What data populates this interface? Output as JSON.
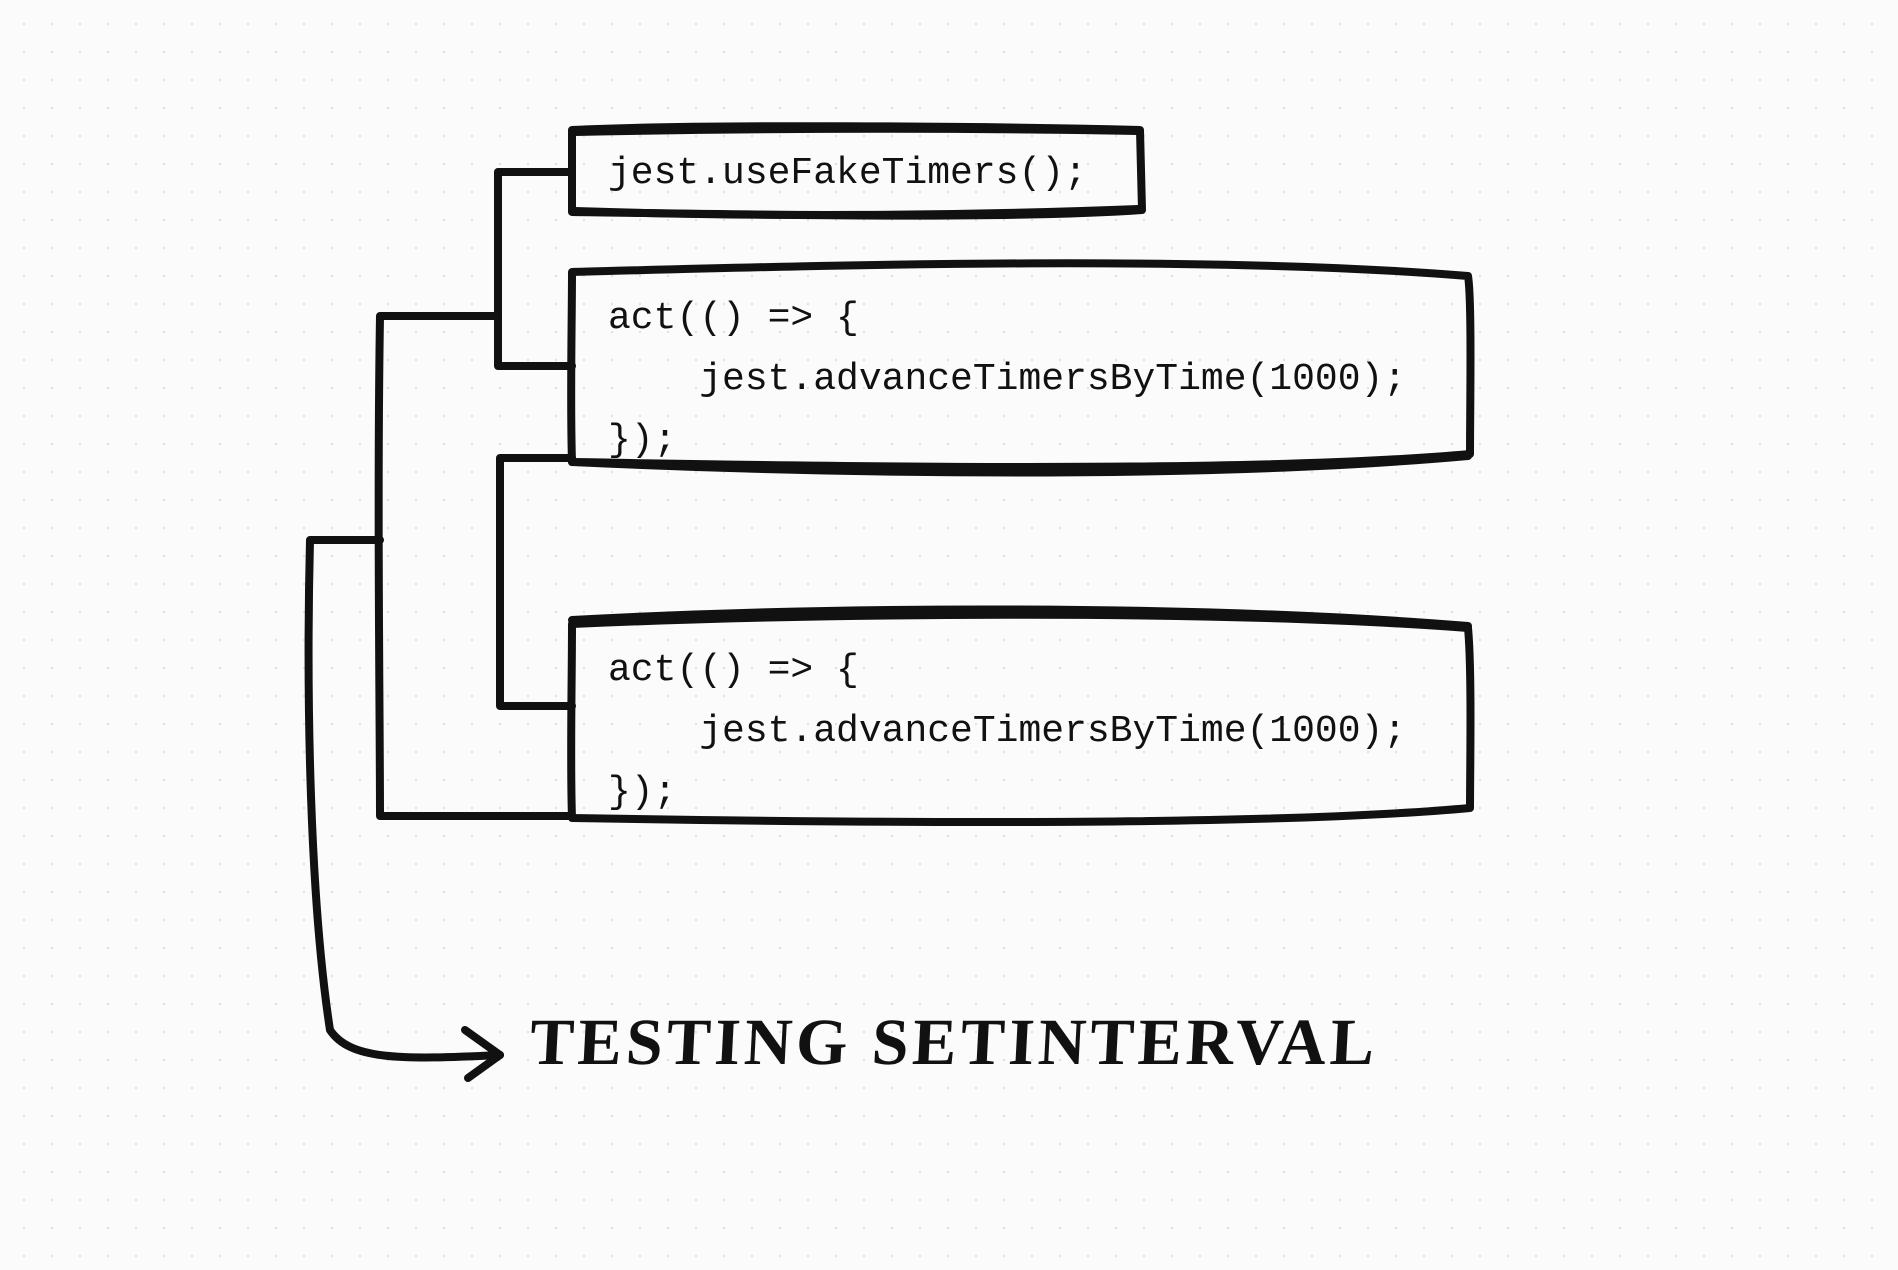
{
  "boxes": {
    "box1": "jest.useFakeTimers();",
    "box2": "act(() => {\n    jest.advanceTimersByTime(1000);\n});",
    "box3": "act(() => {\n    jest.advanceTimersByTime(1000);\n});"
  },
  "title": "TESTING  SETINTERVAL"
}
